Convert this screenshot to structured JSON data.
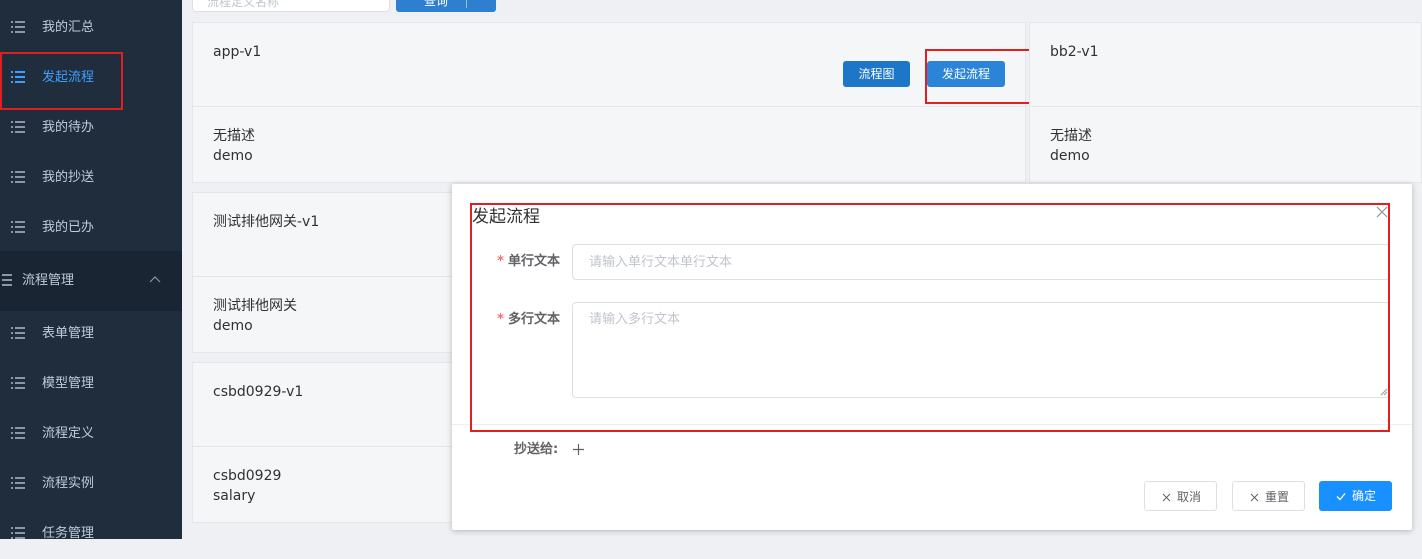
{
  "sidebar": {
    "items": [
      {
        "label": "我的汇总"
      },
      {
        "label": "发起流程"
      },
      {
        "label": "我的待办"
      },
      {
        "label": "我的抄送"
      },
      {
        "label": "我的已办"
      },
      {
        "label": "流程管理"
      },
      {
        "label": "表单管理"
      },
      {
        "label": "模型管理"
      },
      {
        "label": "流程定义"
      },
      {
        "label": "流程实例"
      },
      {
        "label": "任务管理"
      }
    ],
    "active_index": 1,
    "colors": {
      "bg": "#1f2d3d",
      "text": "#bfcbd9",
      "active": "#409eff"
    }
  },
  "search": {
    "placeholder": "流程定义名称",
    "query_label": "查询"
  },
  "cards": [
    {
      "title": "app-v1",
      "desc": "无描述",
      "sub": "demo",
      "diagram_label": "流程图",
      "start_label": "发起流程"
    },
    {
      "title": "bb2-v1",
      "desc": "无描述",
      "sub": "demo"
    },
    {
      "title": "测试排他网关-v1",
      "desc": "测试排他网关",
      "sub": "demo"
    },
    {
      "title": "csbd0929-v1",
      "desc": "csbd0929",
      "sub": "salary"
    }
  ],
  "dialog": {
    "title": "发起流程",
    "fields": [
      {
        "label": "单行文本",
        "required": true,
        "placeholder": "请输入单行文本单行文本"
      },
      {
        "label": "多行文本",
        "required": true,
        "placeholder": "请输入多行文本"
      }
    ],
    "cc_label": "抄送给:",
    "buttons": {
      "cancel": "取消",
      "reset": "重置",
      "confirm": "确定"
    },
    "colors": {
      "confirm": "#1890ff",
      "required": "#f56c6c"
    }
  },
  "highlight_color": "#e02020"
}
